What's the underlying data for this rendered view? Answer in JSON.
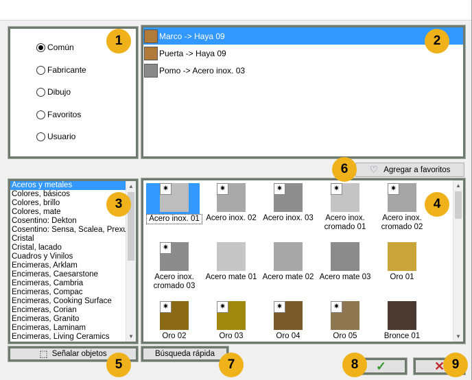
{
  "modes": {
    "options": [
      {
        "label": "Común",
        "checked": true
      },
      {
        "label": "Fabricante",
        "checked": false
      },
      {
        "label": "Dibujo",
        "checked": false
      },
      {
        "label": "Favoritos",
        "checked": false
      },
      {
        "label": "Usuario",
        "checked": false
      }
    ]
  },
  "assignments": [
    {
      "label": "Marco -> Haya 09",
      "color": "#b07a3a",
      "selected": true
    },
    {
      "label": "Puerta -> Haya 09",
      "color": "#b07a3a",
      "selected": false
    },
    {
      "label": "Pomo -> Acero inox. 03",
      "color": "#8a8a8a",
      "selected": false
    }
  ],
  "add_favorites_label": "Agregar a favoritos",
  "categories": [
    "Aceros y metales",
    "Colores, básicos",
    "Colores, brillo",
    "Colores, mate",
    "Cosentino: Dekton",
    "Cosentino: Sensa, Scalea, Prexury",
    "Cristal",
    "Cristal, lacado",
    "Cuadros y Vinilos",
    "Encimeras, Arklam",
    "Encimeras, Caesarstone",
    "Encimeras, Cambria",
    "Encimeras, Compac",
    "Encimeras, Cooking Surface",
    "Encimeras, Corian",
    "Encimeras, Granito",
    "Encimeras, Laminam",
    "Encimeras, Living Ceramics"
  ],
  "materials": [
    {
      "label": "Acero inox. 01",
      "color": "#bdbdbd",
      "sun": true,
      "selected": true
    },
    {
      "label": "Acero inox. 02",
      "color": "#a9a9a9",
      "sun": true
    },
    {
      "label": "Acero inox. 03",
      "color": "#8e8e8e",
      "sun": true
    },
    {
      "label": "Acero inox. cromado 01",
      "color": "#c4c4c4",
      "sun": true
    },
    {
      "label": "Acero inox. cromado 02",
      "color": "#a6a6a6",
      "sun": true
    },
    {
      "label": "Acero inox. cromado 03",
      "color": "#8c8c8c",
      "sun": true
    },
    {
      "label": "Acero mate 01",
      "color": "#c6c6c6",
      "sun": false
    },
    {
      "label": "Acero mate 02",
      "color": "#a8a8a8",
      "sun": false
    },
    {
      "label": "Acero mate 03",
      "color": "#8b8b8b",
      "sun": false
    },
    {
      "label": "Oro 01",
      "color": "#c9a43a",
      "sun": false
    },
    {
      "label": "Oro 02",
      "color": "#8a6a14",
      "sun": true
    },
    {
      "label": "Oro 03",
      "color": "#a0880f",
      "sun": true
    },
    {
      "label": "Oro 04",
      "color": "#7a5a2a",
      "sun": true
    },
    {
      "label": "Oro 05",
      "color": "#8e7650",
      "sun": true
    },
    {
      "label": "Bronce 01",
      "color": "#4a3a30",
      "sun": false
    }
  ],
  "mark_objects_label": "Señalar objetos",
  "quick_search_label": "Búsqueda rápida",
  "badges": [
    "1",
    "2",
    "3",
    "4",
    "5",
    "6",
    "7",
    "8",
    "9"
  ],
  "colors": {
    "accent": "#3398ff",
    "badge": "#f0b21a",
    "ok": "#2e9a2e",
    "cancel": "#c0282d"
  }
}
